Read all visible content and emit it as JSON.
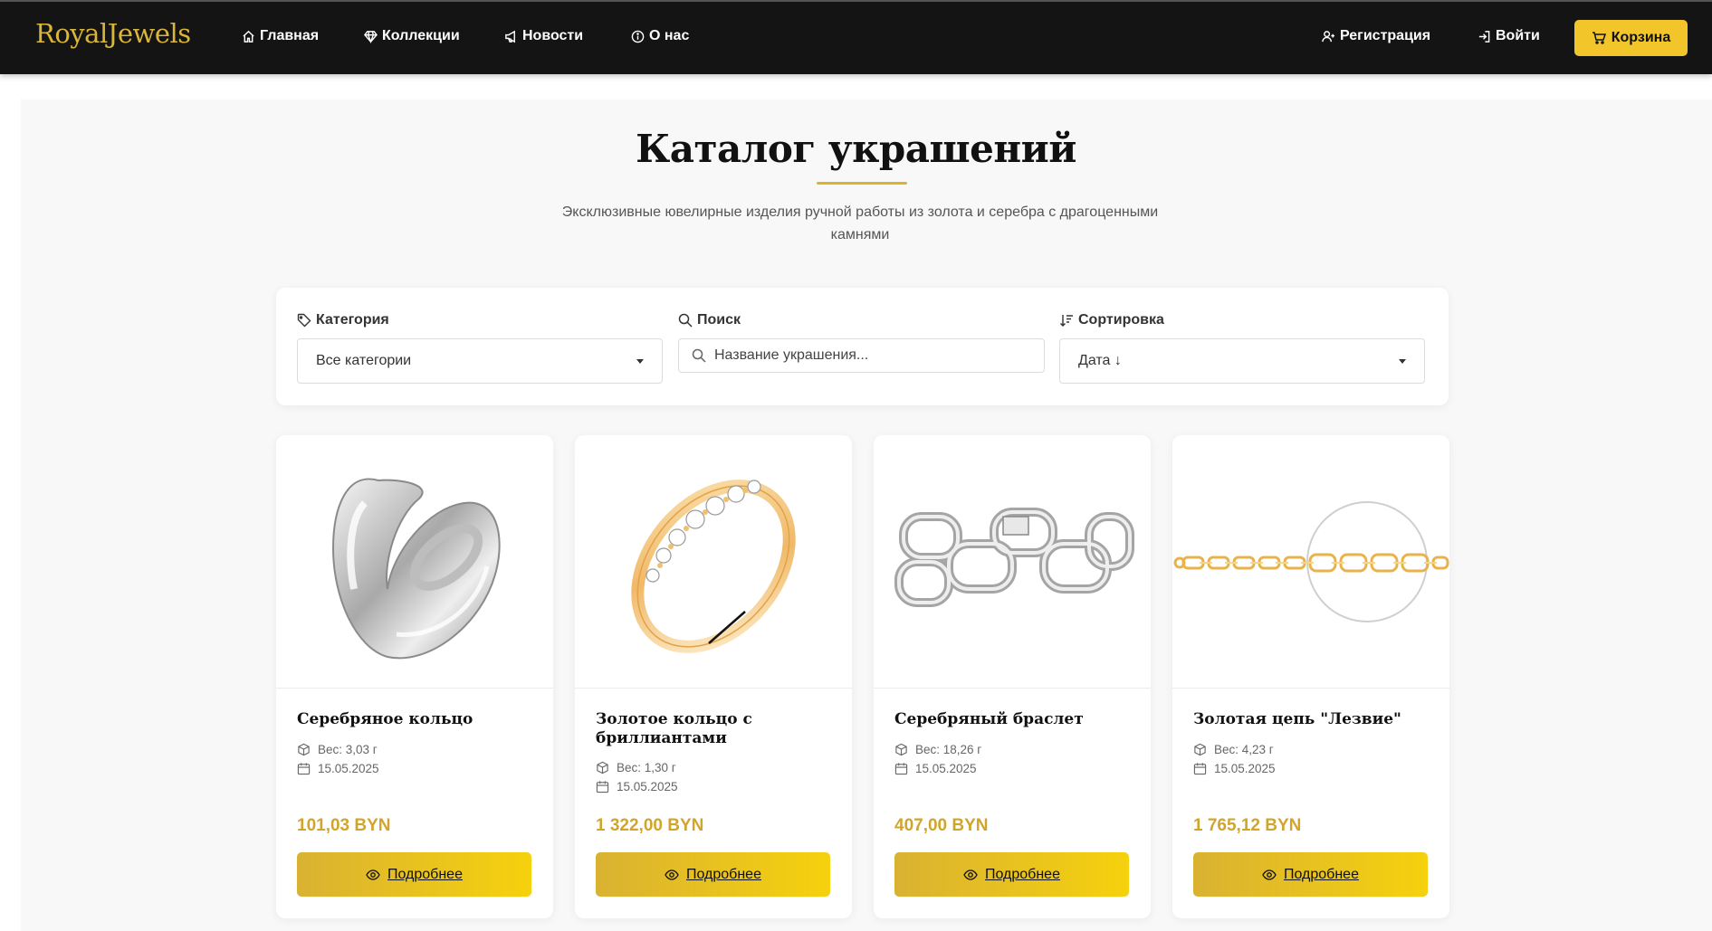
{
  "brand": "RoyalJewels",
  "nav": {
    "links": [
      {
        "label": "Главная",
        "icon": "home-icon"
      },
      {
        "label": "Коллекции",
        "icon": "diamond-icon"
      },
      {
        "label": "Новости",
        "icon": "megaphone-icon"
      },
      {
        "label": "О нас",
        "icon": "info-icon"
      }
    ],
    "register": "Регистрация",
    "login": "Войти",
    "cart": "Корзина"
  },
  "page": {
    "title": "Каталог украшений",
    "subtitle": "Эксклюзивные ювелирные изделия ручной работы из золота и серебра с драгоценными камнями"
  },
  "filters": {
    "category_label": "Категория",
    "category_value": "Все категории",
    "search_label": "Поиск",
    "search_placeholder": "Название украшения...",
    "sort_label": "Сортировка",
    "sort_value": "Дата ↓"
  },
  "products": [
    {
      "name": "Серебряное кольцо",
      "weight": "Вес: 3,03 г",
      "date": "15.05.2025",
      "price": "101,03 BYN",
      "button": "Подробнее"
    },
    {
      "name": "Золотое кольцо с бриллиантами",
      "weight": "Вес: 1,30 г",
      "date": "15.05.2025",
      "price": "1 322,00 BYN",
      "button": "Подробнее"
    },
    {
      "name": "Серебряный браслет",
      "weight": "Вес: 18,26 г",
      "date": "15.05.2025",
      "price": "407,00 BYN",
      "button": "Подробнее"
    },
    {
      "name": "Золотая цепь \"Лезвие\"",
      "weight": "Вес: 4,23 г",
      "date": "15.05.2025",
      "price": "1 765,12 BYN",
      "button": "Подробнее"
    }
  ],
  "colors": {
    "navbar": "#141414",
    "brand": "#d9b53a",
    "accent": "#f2c52a",
    "price": "#d1a52c",
    "page_bg": "#f8f8f8"
  }
}
